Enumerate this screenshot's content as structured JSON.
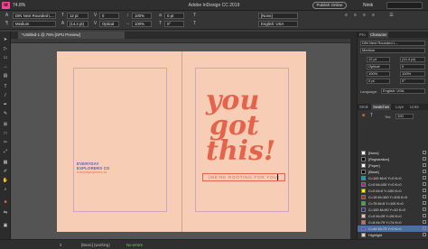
{
  "app": {
    "logo_text": "Id",
    "zoom": "74.8%",
    "window_title": "Adobe InDesign CC 2019",
    "publish_label": "Publish Online",
    "user_name": "Ninik"
  },
  "control_bar": {
    "font_family": "DIN Next Rounded L...",
    "font_style": "Medium",
    "font_size": "12 pt",
    "leading": "(14.4 pt)",
    "tracking": "0",
    "kerning": "Optical",
    "scale_v": "100%",
    "scale_h": "100%",
    "baseline": "0 pt",
    "skew": "0°",
    "char_style": "[None]",
    "language": "English: USA",
    "char_style_placeholder": "[None]",
    "language_short": "English: USA"
  },
  "document": {
    "tab_label": "*Untitled-1 @ 75% [GPU Preview]"
  },
  "artwork": {
    "word1": "you",
    "word2": "got",
    "word3": "this!",
    "subline": "{WE'RE ROOTING FOR YOU}",
    "logo_line1": "EVERYDAY",
    "logo_line2": "EXPLORERS CO",
    "logo_tag": "everydayexplorers.co"
  },
  "colors": {
    "page_bg": "#f8cdb6",
    "lettering": "#e5634a",
    "logo_blue": "#4d5fc4",
    "selection": "#4a6fa3"
  },
  "panel": {
    "tabs_top": [
      "Pro",
      "Character"
    ],
    "font_family": "DIN Next Rounded L...",
    "font_style": "Medium",
    "size": "12 pt",
    "leading": "(14.4 pt)",
    "kerning": "Optical",
    "tracking": "0",
    "language_label": "Language:",
    "language": "English: USA",
    "tabs_bottom": [
      "Strok",
      "Swatches",
      "Laye",
      "Links"
    ],
    "tint_label": "Tint",
    "tint_value": "100",
    "swatches": [
      {
        "name": "[None]",
        "color": "#ffffff"
      },
      {
        "name": "[Registration]",
        "color": "#000000"
      },
      {
        "name": "[Paper]",
        "color": "#ffffff"
      },
      {
        "name": "[Black]",
        "color": "#000000"
      },
      {
        "name": "C=100 M=0 Y=0 K=0",
        "color": "#00a0e3"
      },
      {
        "name": "C=0 M=100 Y=0 K=0",
        "color": "#e5007e"
      },
      {
        "name": "C=0 M=0 Y=100 K=0",
        "color": "#fff100"
      },
      {
        "name": "C=15 M=100 Y=100 K=0",
        "color": "#d01d20"
      },
      {
        "name": "C=75 M=5 Y=100 K=0",
        "color": "#3eab3a"
      },
      {
        "name": "C=100 M=90 Y=10 K=0",
        "color": "#232c8d"
      },
      {
        "name": "C=0 M=29 Y=26 K=0",
        "color": "#f8c2b0"
      },
      {
        "name": "C=6 M=79 Y=74 K=0",
        "color": "#e5634a"
      },
      {
        "name": "C=44 M=73 Y=0 K=0",
        "color": "#4d5fc4"
      },
      {
        "name": "Highlight",
        "color": "#f8cdb6"
      }
    ],
    "selected_swatch_index": 12
  },
  "status": {
    "page_number": "2",
    "layout_label": "[Basic] (working)",
    "errors": "No errors"
  }
}
